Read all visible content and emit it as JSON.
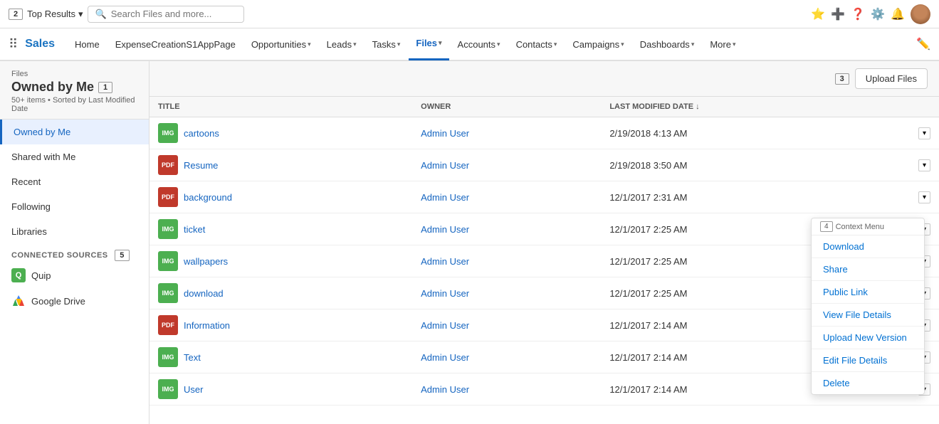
{
  "topbar": {
    "step_badge": "2",
    "top_results_label": "Top Results",
    "search_placeholder": "Search Files and more...",
    "icons": [
      "star",
      "add",
      "help",
      "settings",
      "notifications"
    ]
  },
  "navbar": {
    "brand": "Sales",
    "items": [
      {
        "label": "Home",
        "has_chevron": false,
        "active": false
      },
      {
        "label": "ExpenseCreationS1AppPage",
        "has_chevron": false,
        "active": false
      },
      {
        "label": "Opportunities",
        "has_chevron": true,
        "active": false
      },
      {
        "label": "Leads",
        "has_chevron": true,
        "active": false
      },
      {
        "label": "Tasks",
        "has_chevron": true,
        "active": false
      },
      {
        "label": "Files",
        "has_chevron": true,
        "active": true
      },
      {
        "label": "Accounts",
        "has_chevron": true,
        "active": false
      },
      {
        "label": "Contacts",
        "has_chevron": true,
        "active": false
      },
      {
        "label": "Campaigns",
        "has_chevron": true,
        "active": false
      },
      {
        "label": "Dashboards",
        "has_chevron": true,
        "active": false
      },
      {
        "label": "More",
        "has_chevron": true,
        "active": false
      }
    ]
  },
  "leftnav": {
    "breadcrumb": "Files",
    "title": "Owned by Me",
    "subtitle": "50+ items • Sorted by Last Modified Date",
    "step_badge": "1",
    "items": [
      {
        "label": "Owned by Me",
        "active": true
      },
      {
        "label": "Shared with Me",
        "active": false
      },
      {
        "label": "Recent",
        "active": false
      },
      {
        "label": "Following",
        "active": false
      },
      {
        "label": "Libraries",
        "active": false
      }
    ],
    "connected_sources_label": "CONNECTED SOURCES",
    "step_badge_5": "5",
    "sources": [
      {
        "label": "Quip",
        "type": "quip"
      },
      {
        "label": "Google Drive",
        "type": "gdrive"
      }
    ]
  },
  "main": {
    "upload_btn_label": "Upload Files",
    "step_badge_3": "3",
    "table": {
      "columns": [
        "TITLE",
        "OWNER",
        "LAST MODIFIED DATE ↓"
      ],
      "rows": [
        {
          "name": "cartoons",
          "type": "green",
          "ext": "IMG",
          "owner": "Admin User",
          "date": "2/19/2018 4:13 AM"
        },
        {
          "name": "Resume",
          "type": "red",
          "ext": "PDF",
          "owner": "Admin User",
          "date": "2/19/2018 3:50 AM"
        },
        {
          "name": "background",
          "type": "red",
          "ext": "PDF",
          "owner": "Admin User",
          "date": "12/1/2017 2:31 AM"
        },
        {
          "name": "ticket",
          "type": "green",
          "ext": "IMG",
          "owner": "Admin User",
          "date": "12/1/2017 2:25 AM"
        },
        {
          "name": "wallpapers",
          "type": "green",
          "ext": "IMG",
          "owner": "Admin User",
          "date": "12/1/2017 2:25 AM"
        },
        {
          "name": "download",
          "type": "green",
          "ext": "IMG",
          "owner": "Admin User",
          "date": "12/1/2017 2:25 AM"
        },
        {
          "name": "Information",
          "type": "red",
          "ext": "PDF",
          "owner": "Admin User",
          "date": "12/1/2017 2:14 AM"
        },
        {
          "name": "Text",
          "type": "green",
          "ext": "IMG",
          "owner": "Admin User",
          "date": "12/1/2017 2:14 AM"
        },
        {
          "name": "User",
          "type": "green",
          "ext": "IMG",
          "owner": "Admin User",
          "date": "12/1/2017 2:14 AM"
        }
      ]
    }
  },
  "dropdown": {
    "step_badge_4": "4",
    "items": [
      {
        "label": "Download"
      },
      {
        "label": "Share"
      },
      {
        "label": "Public Link"
      },
      {
        "label": "View File Details"
      },
      {
        "label": "Upload New Version"
      },
      {
        "label": "Edit File Details"
      },
      {
        "label": "Delete"
      }
    ]
  }
}
